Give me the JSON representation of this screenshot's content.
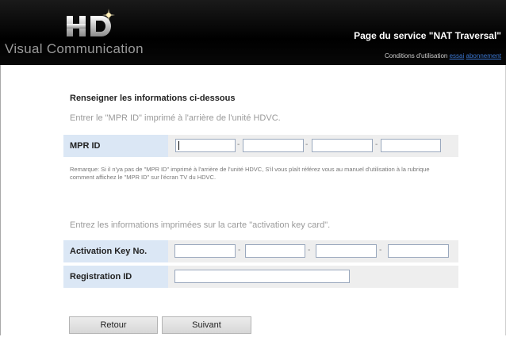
{
  "header": {
    "logo_text": "Visual Communication",
    "site_title": "Page du service \"NAT Traversal\"",
    "links_prefix": "Conditions d'utilisation",
    "link_trial": "essai",
    "link_subscription": "abonnement"
  },
  "form": {
    "section_title": "Renseigner les informations ci-dessous",
    "mpr_hint": "Entrer le \"MPR ID\" imprimé à l'arrière de l'unité HDVC.",
    "mpr_label": "MPR ID",
    "mpr_fields": [
      "",
      "",
      "",
      ""
    ],
    "separator": "-",
    "remark": "Remarque: Si il n'ya pas de \"MPR ID\" imprimé à l'arrière de l'unité HDVC, S'il vous plaît référez vous au manuel d'utilisation à la rubrique comment affichez le \"MPR ID\" sur l'écran TV du HDVC.",
    "activation_hint": "Entrez les informations imprimées sur la carte \"activation key card\".",
    "activation_label": "Activation Key No.",
    "activation_fields": [
      "",
      "",
      "",
      ""
    ],
    "registration_label": "Registration ID",
    "registration_value": ""
  },
  "buttons": {
    "back": "Retour",
    "next": "Suivant"
  }
}
